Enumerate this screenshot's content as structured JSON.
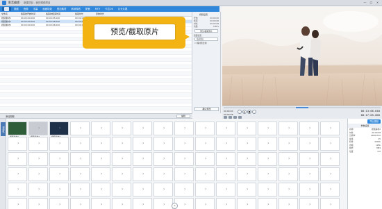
{
  "window": {
    "app_title": "影音编辑",
    "subtitle": "新建项目 - 我的视频项目",
    "buttons": [
      "—",
      "□",
      "×"
    ]
  },
  "tabs": [
    {
      "label": "",
      "icon": "home-icon",
      "active": true
    },
    {
      "label": "视频",
      "active": false
    },
    {
      "label": "音频",
      "active": false
    },
    {
      "label": "字幕",
      "active": false
    },
    {
      "label": "画面特效",
      "active": false
    },
    {
      "label": "叠加素材",
      "active": false
    },
    {
      "label": "转场特效",
      "active": false
    },
    {
      "label": "配音",
      "active": false
    },
    {
      "label": "MTV",
      "active": false
    },
    {
      "label": "卡拉OK",
      "active": false
    },
    {
      "label": "片头片尾",
      "active": false
    }
  ],
  "file_table": {
    "columns": [
      "文件名",
      "截取的开始时间",
      "截取的结束时间",
      "截取时长",
      "原始时长"
    ],
    "rows": [
      {
        "name": "视频素材1",
        "start": "00:00:00.000",
        "end": "00:00:05.000",
        "dur": "00:00:05",
        "orig": "00:00:20",
        "selected": false
      },
      {
        "name": "视频素材2",
        "start": "00:00:00.000",
        "end": "00:00:08.000",
        "dur": "00:00:08",
        "orig": "00:00:15",
        "selected": true
      },
      {
        "name": "视频素材3",
        "start": "00:00:00.000",
        "end": "00:00:06.000",
        "dur": "00:00:06",
        "orig": "00:00:12",
        "selected": false
      }
    ]
  },
  "side_panel": {
    "title": "视频设置",
    "rows": [
      {
        "k": "开始",
        "v": "00:00:00"
      },
      {
        "k": "结束",
        "v": "00:00:08"
      },
      {
        "k": "时长",
        "v": "00:00:08"
      },
      {
        "k": "音量",
        "v": "100%"
      }
    ],
    "crop_button": "预览/截取原片",
    "mode_label": "画面设置",
    "mode_value": "适应窗口",
    "checkbox_label": "保持原比例",
    "bottom_button": "确认修改"
  },
  "callout": {
    "text": "预览/截取原片"
  },
  "preview": {
    "time_left": "00:00:00",
    "time_right": "00:00:08",
    "current_time": "00:13:06.640",
    "total_time": "00:17:05.000"
  },
  "timeline": {
    "header_label": "添加视频",
    "header_button": "编辑",
    "track_tab": "视频轨",
    "clips": [
      {
        "caption": "视频素材1"
      },
      {
        "caption": "视频素材2"
      },
      {
        "caption": "视频素材3"
      }
    ]
  },
  "props_panel": {
    "export_label": "导出视频",
    "title": "参数设置",
    "rows": [
      {
        "k": "名称",
        "v": "视频素材2"
      },
      {
        "k": "时长",
        "v": "00:00:08"
      },
      {
        "k": "分辨率",
        "v": "1280x720"
      },
      {
        "k": "帧率",
        "v": "25"
      },
      {
        "k": "码率",
        "v": "2000k"
      },
      {
        "k": "音频",
        "v": "128k"
      },
      {
        "k": "格式",
        "v": "MP4"
      },
      {
        "k": "位置",
        "v": "0,0"
      }
    ]
  }
}
